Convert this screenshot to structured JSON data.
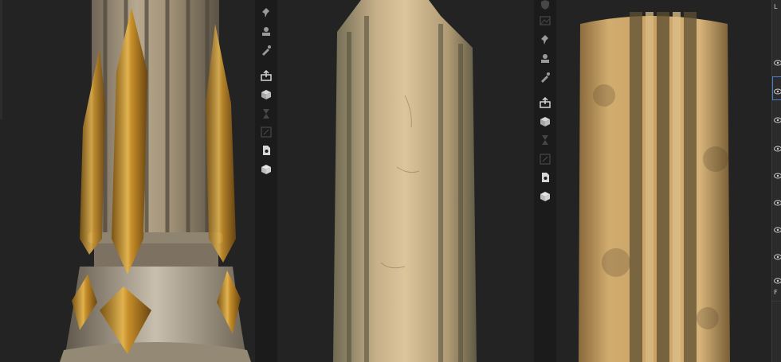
{
  "app": {
    "title": ""
  },
  "viewports": [
    {
      "name": "viewport-left-ornate-column"
    },
    {
      "name": "viewport-middle-broken-column"
    },
    {
      "name": "viewport-right-fluted-column"
    }
  ],
  "toolbar_left": {
    "tools": [
      {
        "icon": "pin-icon",
        "enabled": true
      },
      {
        "icon": "stamp-icon",
        "enabled": true
      },
      {
        "icon": "eyedropper-icon",
        "enabled": true
      },
      {
        "icon": "export-icon",
        "enabled": true
      },
      {
        "icon": "bake-icon",
        "enabled": true
      },
      {
        "icon": "hourglass-icon",
        "enabled": false
      },
      {
        "icon": "resize-icon",
        "enabled": false
      },
      {
        "icon": "document-icon",
        "enabled": true
      },
      {
        "icon": "cube-icon",
        "enabled": true
      }
    ]
  },
  "toolbar_right": {
    "tools": [
      {
        "icon": "shield-icon",
        "enabled": false
      },
      {
        "icon": "image-icon",
        "enabled": false
      },
      {
        "icon": "pin-icon",
        "enabled": true
      },
      {
        "icon": "stamp-icon",
        "enabled": true
      },
      {
        "icon": "eyedropper-icon",
        "enabled": true
      },
      {
        "icon": "export-icon",
        "enabled": true
      },
      {
        "icon": "bake-icon",
        "enabled": true
      },
      {
        "icon": "hourglass-icon",
        "enabled": false
      },
      {
        "icon": "resize-icon",
        "enabled": false
      },
      {
        "icon": "document-icon",
        "enabled": true
      },
      {
        "icon": "cube-icon",
        "enabled": true
      }
    ]
  },
  "layers_panel": {
    "letter": "L",
    "bottom_letter": "F",
    "visible_rows": 9
  },
  "colors": {
    "background": "#232323",
    "toolbar": "#1b1b1b",
    "icon": "#c8c8c8",
    "stone": "#cbb89a",
    "sandstone": "#c9a46a",
    "gold": "#b8862e"
  }
}
